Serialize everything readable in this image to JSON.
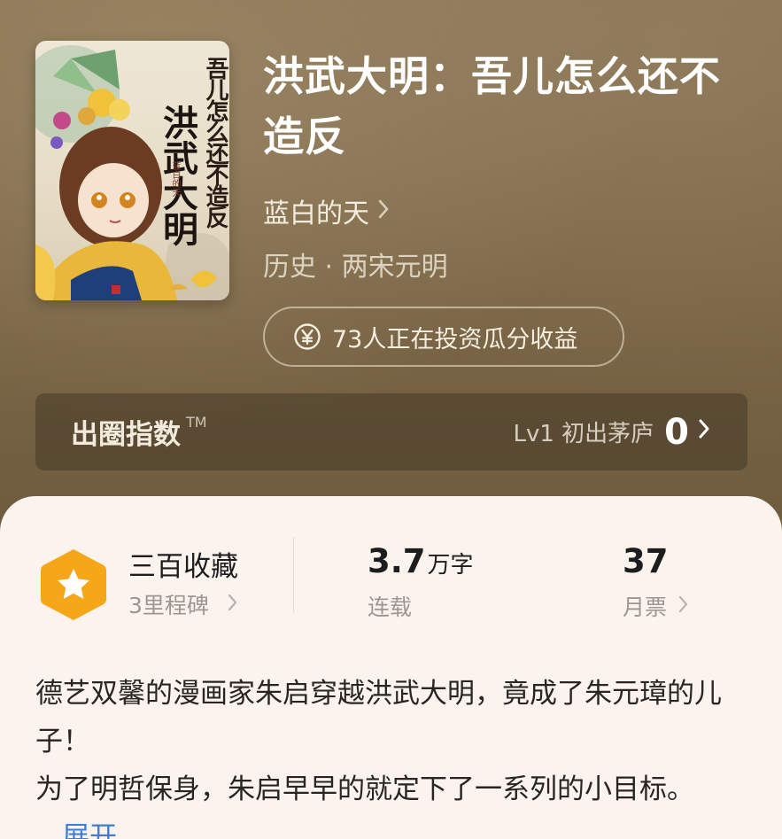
{
  "book": {
    "title": "洪武大明：吾儿怎么还不造反",
    "author": "蓝白的天",
    "category": "历史 · 两宋元明",
    "cover": {
      "title_main": "洪武大明",
      "title_sub": "吾儿怎么还不造反",
      "author_mark": "蓝白的天"
    }
  },
  "investment": {
    "text": "73人正在投资瓜分收益",
    "icon": "yen-circle-icon"
  },
  "index_bar": {
    "label": "出圈指数",
    "trademark": "TM",
    "level_text": "Lv1 初出茅庐",
    "value": "0"
  },
  "stats": {
    "milestone_title": "三百收藏",
    "milestone_sub": "3里程碑",
    "word_count": "3.7",
    "word_unit": "万字",
    "status": "连载",
    "monthly_votes": "37",
    "monthly_votes_label": "月票"
  },
  "description": {
    "line1": "德艺双馨的漫画家朱启穿越洪武大明，竟成了朱元璋的儿子！",
    "line2": "为了明哲保身，朱启早早的就定下了一系列的小目标。",
    "expand": "展开"
  },
  "colors": {
    "badge_orange": "#f6a619",
    "link_blue": "#3f7cd6"
  }
}
